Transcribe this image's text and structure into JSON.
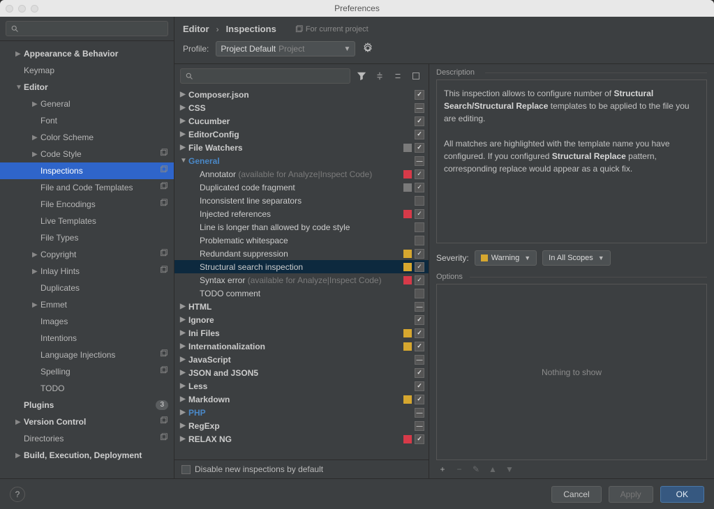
{
  "title": "Preferences",
  "breadcrumb": [
    "Editor",
    "Inspections"
  ],
  "current_project_note": "For current project",
  "profile": {
    "label": "Profile:",
    "name": "Project Default",
    "suffix": "Project"
  },
  "sidebar": [
    {
      "label": "Appearance & Behavior",
      "level": 1,
      "arrow": "▶",
      "bold": true
    },
    {
      "label": "Keymap",
      "level": 1
    },
    {
      "label": "Editor",
      "level": 1,
      "arrow": "▼",
      "bold": true
    },
    {
      "label": "General",
      "level": 2,
      "arrow": "▶"
    },
    {
      "label": "Font",
      "level": 2
    },
    {
      "label": "Color Scheme",
      "level": 2,
      "arrow": "▶"
    },
    {
      "label": "Code Style",
      "level": 2,
      "arrow": "▶",
      "badge": true
    },
    {
      "label": "Inspections",
      "level": 2,
      "sel": true,
      "badge": true
    },
    {
      "label": "File and Code Templates",
      "level": 2,
      "badge": true
    },
    {
      "label": "File Encodings",
      "level": 2,
      "badge": true
    },
    {
      "label": "Live Templates",
      "level": 2
    },
    {
      "label": "File Types",
      "level": 2
    },
    {
      "label": "Copyright",
      "level": 2,
      "arrow": "▶",
      "badge": true
    },
    {
      "label": "Inlay Hints",
      "level": 2,
      "arrow": "▶",
      "badge": true
    },
    {
      "label": "Duplicates",
      "level": 2
    },
    {
      "label": "Emmet",
      "level": 2,
      "arrow": "▶"
    },
    {
      "label": "Images",
      "level": 2
    },
    {
      "label": "Intentions",
      "level": 2
    },
    {
      "label": "Language Injections",
      "level": 2,
      "badge": true
    },
    {
      "label": "Spelling",
      "level": 2,
      "badge": true
    },
    {
      "label": "TODO",
      "level": 2
    },
    {
      "label": "Plugins",
      "level": 1,
      "bold": true,
      "count": "3"
    },
    {
      "label": "Version Control",
      "level": 1,
      "arrow": "▶",
      "bold": true,
      "badge": true
    },
    {
      "label": "Directories",
      "level": 1,
      "badge": true
    },
    {
      "label": "Build, Execution, Deployment",
      "level": 1,
      "arrow": "▶",
      "bold": true
    }
  ],
  "inspections": [
    {
      "label": "Composer.json",
      "cat": true,
      "arrow": "▶",
      "chk": "on"
    },
    {
      "label": "CSS",
      "cat": true,
      "arrow": "▶",
      "chk": "mixed"
    },
    {
      "label": "Cucumber",
      "cat": true,
      "arrow": "▶",
      "chk": "on"
    },
    {
      "label": "EditorConfig",
      "cat": true,
      "arrow": "▶",
      "chk": "on"
    },
    {
      "label": "File Watchers",
      "cat": true,
      "arrow": "▶",
      "chk": "on",
      "sev": "grey"
    },
    {
      "label": "General",
      "cat": true,
      "arrow": "▼",
      "chk": "mixed",
      "blue": true
    },
    {
      "label": "Annotator",
      "dim": "(available for Analyze|Inspect Code)",
      "chk": "on",
      "sev": "red"
    },
    {
      "label": "Duplicated code fragment",
      "chk": "on",
      "sev": "grey"
    },
    {
      "label": "Inconsistent line separators",
      "chk": "off"
    },
    {
      "label": "Injected references",
      "chk": "on",
      "sev": "red"
    },
    {
      "label": "Line is longer than allowed by code style",
      "chk": "off"
    },
    {
      "label": "Problematic whitespace",
      "chk": "off"
    },
    {
      "label": "Redundant suppression",
      "chk": "on",
      "sev": "orange"
    },
    {
      "label": "Structural search inspection",
      "chk": "on",
      "sev": "orange",
      "sel": true
    },
    {
      "label": "Syntax error",
      "dim": "(available for Analyze|Inspect Code)",
      "chk": "on",
      "sev": "red"
    },
    {
      "label": "TODO comment",
      "chk": "off"
    },
    {
      "label": "HTML",
      "cat": true,
      "arrow": "▶",
      "chk": "mixed"
    },
    {
      "label": "Ignore",
      "cat": true,
      "arrow": "▶",
      "chk": "on"
    },
    {
      "label": "Ini Files",
      "cat": true,
      "arrow": "▶",
      "chk": "on",
      "sev": "orange"
    },
    {
      "label": "Internationalization",
      "cat": true,
      "arrow": "▶",
      "chk": "on",
      "sev": "orange"
    },
    {
      "label": "JavaScript",
      "cat": true,
      "arrow": "▶",
      "chk": "mixed"
    },
    {
      "label": "JSON and JSON5",
      "cat": true,
      "arrow": "▶",
      "chk": "on"
    },
    {
      "label": "Less",
      "cat": true,
      "arrow": "▶",
      "chk": "on"
    },
    {
      "label": "Markdown",
      "cat": true,
      "arrow": "▶",
      "chk": "on",
      "sev": "orange"
    },
    {
      "label": "PHP",
      "cat": true,
      "arrow": "▶",
      "chk": "mixed",
      "blue": true
    },
    {
      "label": "RegExp",
      "cat": true,
      "arrow": "▶",
      "chk": "mixed"
    },
    {
      "label": "RELAX NG",
      "cat": true,
      "arrow": "▶",
      "chk": "on",
      "sev": "red"
    }
  ],
  "disable_new": "Disable new inspections by default",
  "desc_label": "Description",
  "desc_p1a": "This inspection allows to configure number of ",
  "desc_p1b": "Structural Search/Structural Replace",
  "desc_p1c": " templates to be applied to the file you are editing.",
  "desc_p2a": "All matches are highlighted with the template name you have configured. If you configured ",
  "desc_p2b": "Structural Replace",
  "desc_p2c": " pattern, corresponding replace would appear as a quick fix.",
  "severity": {
    "label": "Severity:",
    "value": "Warning",
    "scope": "In All Scopes"
  },
  "options": {
    "label": "Options",
    "empty": "Nothing to show"
  },
  "buttons": {
    "cancel": "Cancel",
    "apply": "Apply",
    "ok": "OK"
  }
}
